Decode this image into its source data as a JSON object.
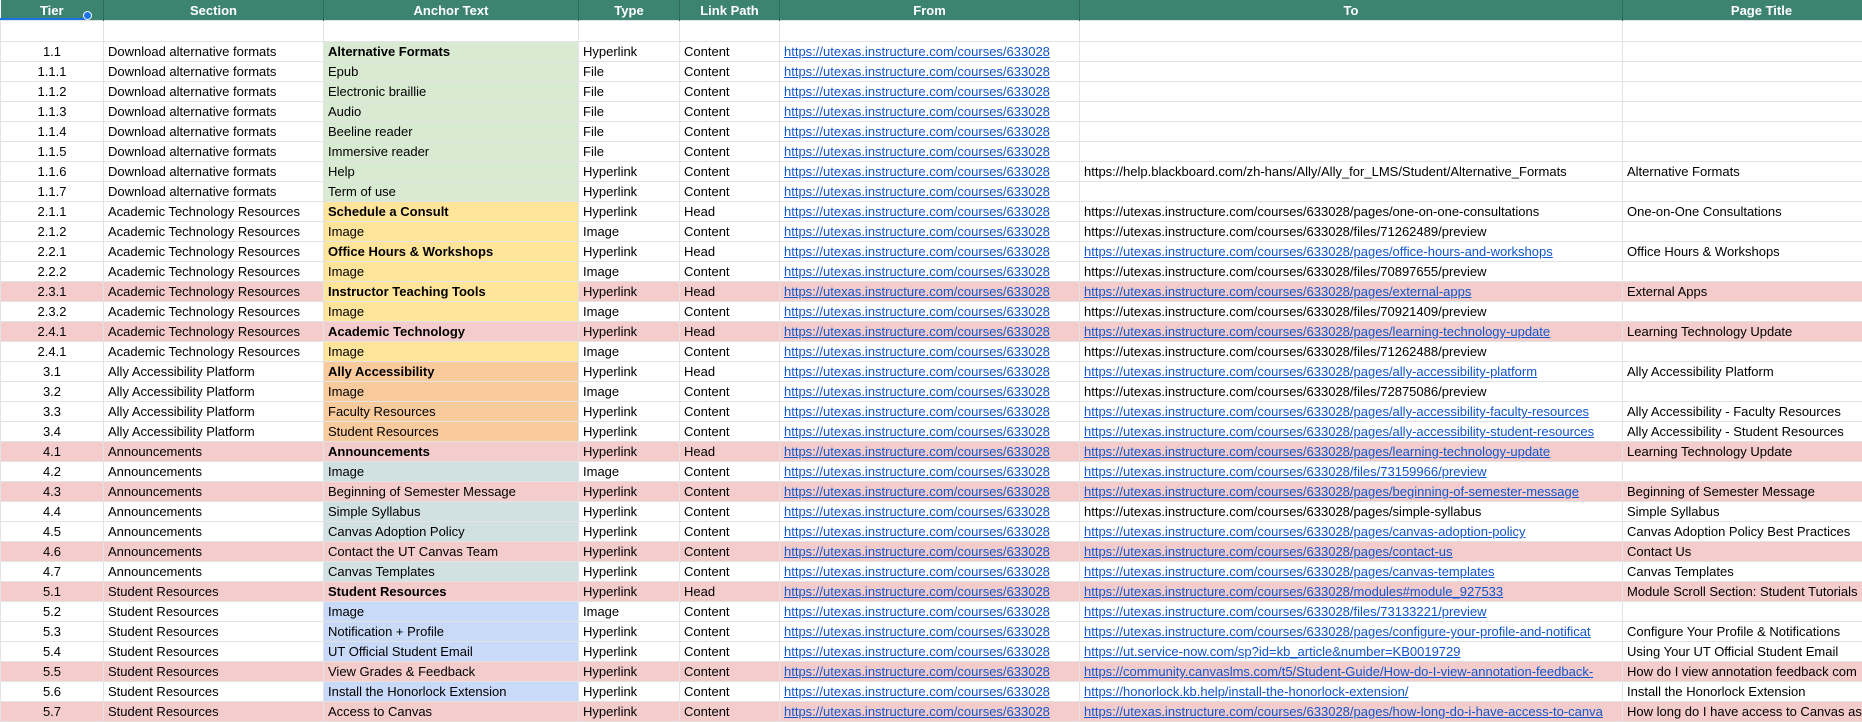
{
  "headers": [
    "Tier",
    "Section",
    "Anchor Text",
    "Type",
    "Link Path",
    "From",
    "To",
    "Page Title"
  ],
  "rows": [
    {
      "tier": "1.1",
      "section": "Download alternative formats",
      "anchor": "Alternative Formats",
      "type": "Hyperlink",
      "path": "Content",
      "from": "https://utexas.instructure.com/courses/633028",
      "to": "",
      "title": "",
      "bold": true,
      "ac": "green",
      "row": ""
    },
    {
      "tier": "1.1.1",
      "section": "Download alternative formats",
      "anchor": "Epub",
      "type": "File",
      "path": "Content",
      "from": "https://utexas.instructure.com/courses/633028",
      "to": "",
      "title": "",
      "bold": false,
      "ac": "green",
      "row": ""
    },
    {
      "tier": "1.1.2",
      "section": "Download alternative formats",
      "anchor": "Electronic braillie",
      "type": "File",
      "path": "Content",
      "from": "https://utexas.instructure.com/courses/633028",
      "to": "",
      "title": "",
      "bold": false,
      "ac": "green",
      "row": ""
    },
    {
      "tier": "1.1.3",
      "section": "Download alternative formats",
      "anchor": "Audio",
      "type": "File",
      "path": "Content",
      "from": "https://utexas.instructure.com/courses/633028",
      "to": "",
      "title": "",
      "bold": false,
      "ac": "green",
      "row": ""
    },
    {
      "tier": "1.1.4",
      "section": "Download alternative formats",
      "anchor": "Beeline reader",
      "type": "File",
      "path": "Content",
      "from": "https://utexas.instructure.com/courses/633028",
      "to": "",
      "title": "",
      "bold": false,
      "ac": "green",
      "row": ""
    },
    {
      "tier": "1.1.5",
      "section": "Download alternative formats",
      "anchor": "Immersive reader",
      "type": "File",
      "path": "Content",
      "from": "https://utexas.instructure.com/courses/633028",
      "to": "",
      "title": "",
      "bold": false,
      "ac": "green",
      "row": ""
    },
    {
      "tier": "1.1.6",
      "section": "Download alternative formats",
      "anchor": "Help",
      "type": "Hyperlink",
      "path": "Content",
      "from": "https://utexas.instructure.com/courses/633028",
      "to": "https://help.blackboard.com/zh-hans/Ally/Ally_for_LMS/Student/Alternative_Formats",
      "title": "Alternative Formats",
      "bold": false,
      "ac": "green",
      "row": "",
      "tolink": false
    },
    {
      "tier": "1.1.7",
      "section": "Download alternative formats",
      "anchor": "Term of use",
      "type": "Hyperlink",
      "path": "Content",
      "from": "https://utexas.instructure.com/courses/633028",
      "to": "",
      "title": "",
      "bold": false,
      "ac": "green",
      "row": ""
    },
    {
      "tier": "2.1.1",
      "section": "Academic Technology Resources",
      "anchor": "Schedule a Consult",
      "type": "Hyperlink",
      "path": "Head",
      "from": "https://utexas.instructure.com/courses/633028",
      "to": "https://utexas.instructure.com/courses/633028/pages/one-on-one-consultations",
      "title": "One-on-One Consultations",
      "bold": true,
      "ac": "yellow",
      "row": "",
      "tolink": false
    },
    {
      "tier": "2.1.2",
      "section": "Academic Technology Resources",
      "anchor": "Image",
      "type": "Image",
      "path": "Content",
      "from": "https://utexas.instructure.com/courses/633028",
      "to": "https://utexas.instructure.com/courses/633028/files/71262489/preview",
      "title": "",
      "bold": false,
      "ac": "yellow",
      "row": "",
      "tolink": false
    },
    {
      "tier": "2.2.1",
      "section": "Academic Technology Resources",
      "anchor": "Office Hours & Workshops",
      "type": "Hyperlink",
      "path": "Head",
      "from": "https://utexas.instructure.com/courses/633028",
      "to": "https://utexas.instructure.com/courses/633028/pages/office-hours-and-workshops",
      "title": "Office Hours & Workshops",
      "bold": true,
      "ac": "yellow",
      "row": "",
      "tolink": true
    },
    {
      "tier": "2.2.2",
      "section": "Academic Technology Resources",
      "anchor": "Image",
      "type": "Image",
      "path": "Content",
      "from": "https://utexas.instructure.com/courses/633028",
      "to": "https://utexas.instructure.com/courses/633028/files/70897655/preview",
      "title": "",
      "bold": false,
      "ac": "yellow",
      "row": "",
      "tolink": false
    },
    {
      "tier": "2.3.1",
      "section": "Academic Technology Resources",
      "anchor": "Instructor Teaching Tools",
      "type": "Hyperlink",
      "path": "Head",
      "from": "https://utexas.instructure.com/courses/633028",
      "to": "https://utexas.instructure.com/courses/633028/pages/external-apps",
      "title": "External Apps",
      "bold": true,
      "ac": "yellow",
      "row": "pink",
      "tolink": true
    },
    {
      "tier": "2.3.2",
      "section": "Academic Technology Resources",
      "anchor": "Image",
      "type": "Image",
      "path": "Content",
      "from": "https://utexas.instructure.com/courses/633028",
      "to": "https://utexas.instructure.com/courses/633028/files/70921409/preview",
      "title": "",
      "bold": false,
      "ac": "yellow",
      "row": "",
      "tolink": false
    },
    {
      "tier": "2.4.1",
      "section": "Academic Technology Resources",
      "anchor": "Academic Technology",
      "type": "Hyperlink",
      "path": "Head",
      "from": "https://utexas.instructure.com/courses/633028",
      "to": "https://utexas.instructure.com/courses/633028/pages/learning-technology-update",
      "title": "Learning Technology Update",
      "bold": true,
      "ac": "rose",
      "row": "pink",
      "tolink": true
    },
    {
      "tier": "2.4.1",
      "section": "Academic Technology Resources",
      "anchor": "Image",
      "type": "Image",
      "path": "Content",
      "from": "https://utexas.instructure.com/courses/633028",
      "to": "https://utexas.instructure.com/courses/633028/files/71262488/preview",
      "title": "",
      "bold": false,
      "ac": "yellow",
      "row": "",
      "tolink": false
    },
    {
      "tier": "3.1",
      "section": "Ally Accessibility Platform",
      "anchor": "Ally Accessibility",
      "type": "Hyperlink",
      "path": "Head",
      "from": "https://utexas.instructure.com/courses/633028",
      "to": "https://utexas.instructure.com/courses/633028/pages/ally-accessibility-platform",
      "title": "Ally Accessibility Platform",
      "bold": true,
      "ac": "orange",
      "row": "",
      "tolink": true
    },
    {
      "tier": "3.2",
      "section": "Ally Accessibility Platform",
      "anchor": "Image",
      "type": "Image",
      "path": "Content",
      "from": "https://utexas.instructure.com/courses/633028",
      "to": "https://utexas.instructure.com/courses/633028/files/72875086/preview",
      "title": "",
      "bold": false,
      "ac": "orange",
      "row": "",
      "tolink": false
    },
    {
      "tier": "3.3",
      "section": "Ally Accessibility Platform",
      "anchor": "Faculty Resources",
      "type": "Hyperlink",
      "path": "Content",
      "from": "https://utexas.instructure.com/courses/633028",
      "to": "https://utexas.instructure.com/courses/633028/pages/ally-accessibility-faculty-resources",
      "title": "Ally Accessibility - Faculty Resources",
      "bold": false,
      "ac": "orange",
      "row": "",
      "tolink": true
    },
    {
      "tier": "3.4",
      "section": "Ally Accessibility Platform",
      "anchor": "Student Resources",
      "type": "Hyperlink",
      "path": "Content",
      "from": "https://utexas.instructure.com/courses/633028",
      "to": "https://utexas.instructure.com/courses/633028/pages/ally-accessibility-student-resources",
      "title": "Ally Accessibility - Student Resources",
      "bold": false,
      "ac": "orange",
      "row": "",
      "tolink": true
    },
    {
      "tier": "4.1",
      "section": "Announcements",
      "anchor": "Announcements",
      "type": "Hyperlink",
      "path": "Head",
      "from": "https://utexas.instructure.com/courses/633028",
      "to": "https://utexas.instructure.com/courses/633028/pages/learning-technology-update",
      "title": "Learning Technology Update",
      "bold": true,
      "ac": "rose",
      "row": "pink",
      "tolink": true
    },
    {
      "tier": "4.2",
      "section": "Announcements",
      "anchor": "Image",
      "type": "Image",
      "path": "Content",
      "from": "https://utexas.instructure.com/courses/633028",
      "to": "https://utexas.instructure.com/courses/633028/files/73159966/preview",
      "title": "",
      "bold": false,
      "ac": "blue",
      "row": "",
      "tolink": true
    },
    {
      "tier": "4.3",
      "section": "Announcements",
      "anchor": "Beginning of Semester Message",
      "type": "Hyperlink",
      "path": "Content",
      "from": "https://utexas.instructure.com/courses/633028",
      "to": "https://utexas.instructure.com/courses/633028/pages/beginning-of-semester-message",
      "title": "Beginning of Semester Message",
      "bold": false,
      "ac": "rose",
      "row": "pink",
      "tolink": true
    },
    {
      "tier": "4.4",
      "section": "Announcements",
      "anchor": "Simple Syllabus",
      "type": "Hyperlink",
      "path": "Content",
      "from": "https://utexas.instructure.com/courses/633028",
      "to": "https://utexas.instructure.com/courses/633028/pages/simple-syllabus",
      "title": "Simple Syllabus",
      "bold": false,
      "ac": "blue",
      "row": "",
      "tolink": false
    },
    {
      "tier": "4.5",
      "section": "Announcements",
      "anchor": "Canvas Adoption Policy",
      "type": "Hyperlink",
      "path": "Content",
      "from": "https://utexas.instructure.com/courses/633028",
      "to": "https://utexas.instructure.com/courses/633028/pages/canvas-adoption-policy",
      "title": "Canvas Adoption Policy Best Practices",
      "bold": false,
      "ac": "blue",
      "row": "",
      "tolink": true
    },
    {
      "tier": "4.6",
      "section": "Announcements",
      "anchor": "Contact the UT Canvas Team",
      "type": "Hyperlink",
      "path": "Content",
      "from": "https://utexas.instructure.com/courses/633028",
      "to": "https://utexas.instructure.com/courses/633028/pages/contact-us",
      "title": "Contact Us",
      "bold": false,
      "ac": "rose",
      "row": "pink",
      "tolink": true
    },
    {
      "tier": "4.7",
      "section": "Announcements",
      "anchor": "Canvas Templates",
      "type": "Hyperlink",
      "path": "Content",
      "from": "https://utexas.instructure.com/courses/633028",
      "to": "https://utexas.instructure.com/courses/633028/pages/canvas-templates",
      "title": "Canvas Templates",
      "bold": false,
      "ac": "blue",
      "row": "",
      "tolink": true
    },
    {
      "tier": "5.1",
      "section": "Student Resources",
      "anchor": "Student Resources",
      "type": "Hyperlink",
      "path": "Head",
      "from": "https://utexas.instructure.com/courses/633028",
      "to": "https://utexas.instructure.com/courses/633028/modules#module_927533",
      "title": "Module Scroll Section: Student Tutorials",
      "bold": true,
      "ac": "rose",
      "row": "pink",
      "tolink": true
    },
    {
      "tier": "5.2",
      "section": "Student Resources",
      "anchor": "Image",
      "type": "Image",
      "path": "Content",
      "from": "https://utexas.instructure.com/courses/633028",
      "to": "https://utexas.instructure.com/courses/633028/files/73133221/preview",
      "title": "",
      "bold": false,
      "ac": "lblue",
      "row": "",
      "tolink": true
    },
    {
      "tier": "5.3",
      "section": "Student Resources",
      "anchor": "Notification + Profile",
      "type": "Hyperlink",
      "path": "Content",
      "from": "https://utexas.instructure.com/courses/633028",
      "to": "https://utexas.instructure.com/courses/633028/pages/configure-your-profile-and-notificat",
      "title": "Configure Your Profile & Notifications",
      "bold": false,
      "ac": "lblue",
      "row": "",
      "tolink": true
    },
    {
      "tier": "5.4",
      "section": "Student Resources",
      "anchor": "UT Official Student Email",
      "type": "Hyperlink",
      "path": "Content",
      "from": "https://utexas.instructure.com/courses/633028",
      "to": "https://ut.service-now.com/sp?id=kb_article&number=KB0019729",
      "title": "Using Your UT Official Student Email",
      "bold": false,
      "ac": "lblue",
      "row": "",
      "tolink": true
    },
    {
      "tier": "5.5",
      "section": "Student Resources",
      "anchor": "View Grades & Feedback",
      "type": "Hyperlink",
      "path": "Content",
      "from": "https://utexas.instructure.com/courses/633028",
      "to": "https://community.canvaslms.com/t5/Student-Guide/How-do-I-view-annotation-feedback-",
      "title": "How do I view annotation feedback com",
      "bold": false,
      "ac": "rose",
      "row": "pink",
      "tolink": true
    },
    {
      "tier": "5.6",
      "section": "Student Resources",
      "anchor": "Install the Honorlock Extension",
      "type": "Hyperlink",
      "path": "Content",
      "from": "https://utexas.instructure.com/courses/633028",
      "to": "https://honorlock.kb.help/install-the-honorlock-extension/",
      "title": "Install the Honorlock Extension",
      "bold": false,
      "ac": "lblue",
      "row": "",
      "tolink": true
    },
    {
      "tier": "5.7",
      "section": "Student Resources",
      "anchor": "Access to Canvas",
      "type": "Hyperlink",
      "path": "Content",
      "from": "https://utexas.instructure.com/courses/633028",
      "to": "https://utexas.instructure.com/courses/633028/pages/how-long-do-i-have-access-to-canva",
      "title": "How long do I have access to Canvas as",
      "bold": false,
      "ac": "rose",
      "row": "pink",
      "tolink": true
    }
  ]
}
